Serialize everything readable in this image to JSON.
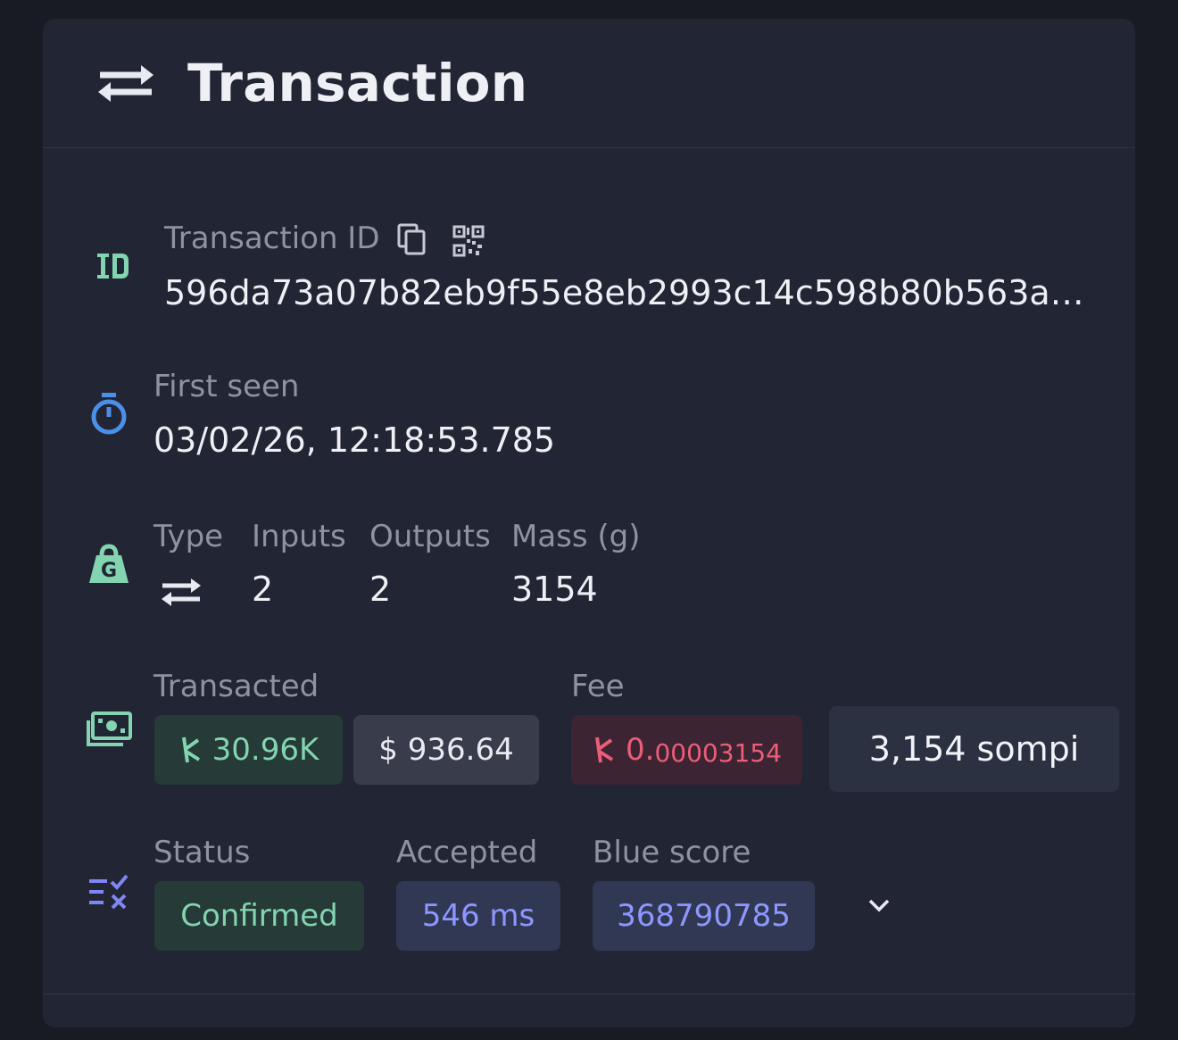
{
  "header": {
    "title": "Transaction",
    "icon": "transfer-arrows-icon"
  },
  "transaction_id": {
    "label": "Transaction ID",
    "value": "596da73a07b82eb9f55e8eb2993c14c598b80b563a…",
    "icons": [
      "id-icon",
      "copy-icon",
      "qr-code-icon"
    ]
  },
  "first_seen": {
    "label": "First seen",
    "value": "03/02/26, 12:18:53.785",
    "icon": "stopwatch-icon"
  },
  "details": {
    "icon": "weight-icon",
    "type_label": "Type",
    "type_icon": "transfer-arrows-icon",
    "inputs_label": "Inputs",
    "inputs_value": "2",
    "outputs_label": "Outputs",
    "outputs_value": "2",
    "mass_label": "Mass (g)",
    "mass_value": "3154"
  },
  "amounts": {
    "icon": "money-icon",
    "transacted_label": "Transacted",
    "transacted_kas": "30.96K",
    "transacted_usd": "$ 936.64",
    "fee_label": "Fee",
    "fee_main": "0.",
    "fee_small": "00003154",
    "fee_sompi": "3,154 sompi",
    "currency_icon": "kaspa-icon"
  },
  "status": {
    "icon": "checklist-icon",
    "status_label": "Status",
    "status_value": "Confirmed",
    "accepted_label": "Accepted",
    "accepted_value": "546 ms",
    "blue_score_label": "Blue score",
    "blue_score_value": "368790785"
  },
  "colors": {
    "background": "#191b24",
    "card": "#222533",
    "accent_green": "#83d4b1",
    "accent_blue": "#8e97ff",
    "accent_red": "#ec5d78",
    "icon_blue": "#4a90e8",
    "icon_purple": "#7f86f5"
  }
}
